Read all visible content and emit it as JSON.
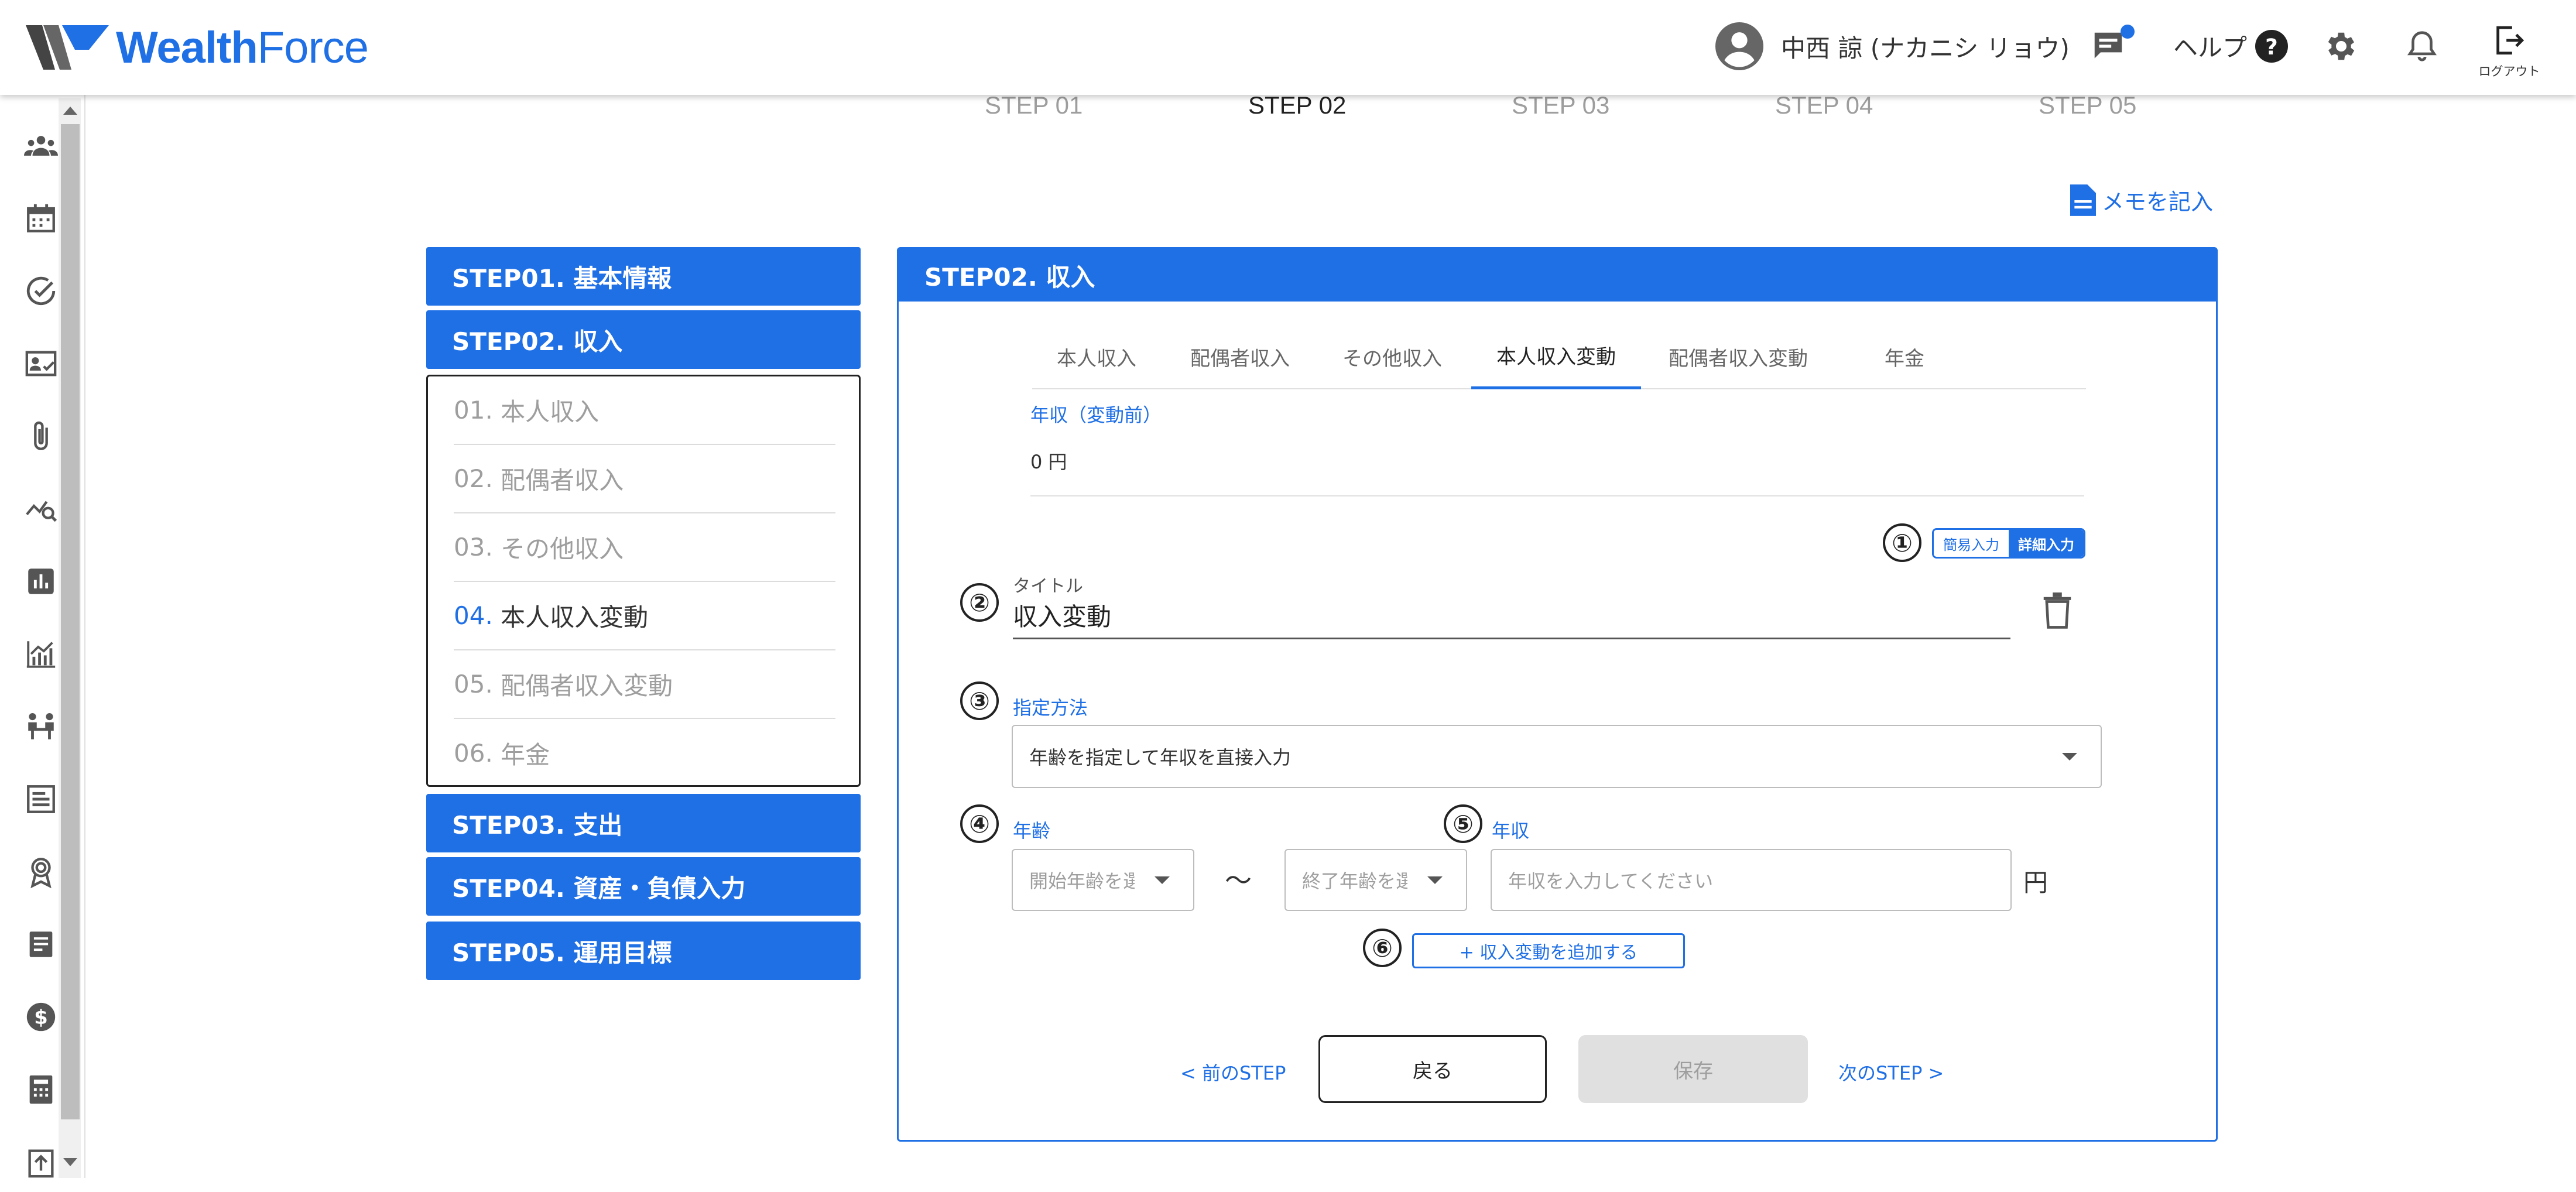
{
  "header": {
    "logo_bold": "Wealth",
    "logo_light": "Force",
    "user_name": "中西 諒 (ナカニシ リョウ)",
    "help_label": "ヘルプ",
    "logout_label": "ログアウト"
  },
  "rail_icons": [
    "people-icon",
    "calendar-icon",
    "check-circle-icon",
    "contact-card-icon",
    "paperclip-icon",
    "analytics-search-icon",
    "bar-chart-icon",
    "line-chart-icon",
    "meeting-icon",
    "article-icon",
    "award-icon",
    "document-icon",
    "dollar-icon",
    "calculator-icon",
    "upload-icon"
  ],
  "stepper": [
    "STEP 01",
    "STEP 02",
    "STEP 03",
    "STEP 04",
    "STEP 05"
  ],
  "memo_label": "メモを記入",
  "side_nav": {
    "step1": "STEP01. 基本情報",
    "step2": "STEP02. 収入",
    "sub_items": [
      {
        "num": "01.",
        "label": "本人収入"
      },
      {
        "num": "02.",
        "label": "配偶者収入"
      },
      {
        "num": "03.",
        "label": "その他収入"
      },
      {
        "num": "04.",
        "label": "本人収入変動"
      },
      {
        "num": "05.",
        "label": "配偶者収入変動"
      },
      {
        "num": "06.",
        "label": "年金"
      }
    ],
    "step3": "STEP03. 支出",
    "step4": "STEP04. 資産・負債入力",
    "step5": "STEP05. 運用目標"
  },
  "panel": {
    "title": "STEP02. 収入",
    "tabs": [
      "本人収入",
      "配偶者収入",
      "その他収入",
      "本人収入変動",
      "配偶者収入変動",
      "年金"
    ],
    "active_tab": "本人収入変動",
    "annual_before_label": "年収（変動前）",
    "annual_before_value": "0 円",
    "toggle_simple": "簡易入力",
    "toggle_detail": "詳細入力",
    "title_label": "タイトル",
    "title_value": "収入変動",
    "method_label": "指定方法",
    "method_value": "年齢を指定して年収を直接入力",
    "age_label": "年齢",
    "start_age_placeholder": "開始年齢を選択",
    "tilde": "〜",
    "end_age_placeholder": "終了年齢を選択",
    "income_label": "年収",
    "income_placeholder": "年収を入力してください",
    "yen": "円",
    "add_button": "+ 収入変動を追加する",
    "prev_step": "< 前のSTEP",
    "back_button": "戻る",
    "save_button": "保存",
    "next_step": "次のSTEP >"
  },
  "markers": [
    "①",
    "②",
    "③",
    "④",
    "⑤",
    "⑥"
  ],
  "colors": {
    "accent": "#1f6fe5",
    "disabled": "#e0e0e0"
  }
}
